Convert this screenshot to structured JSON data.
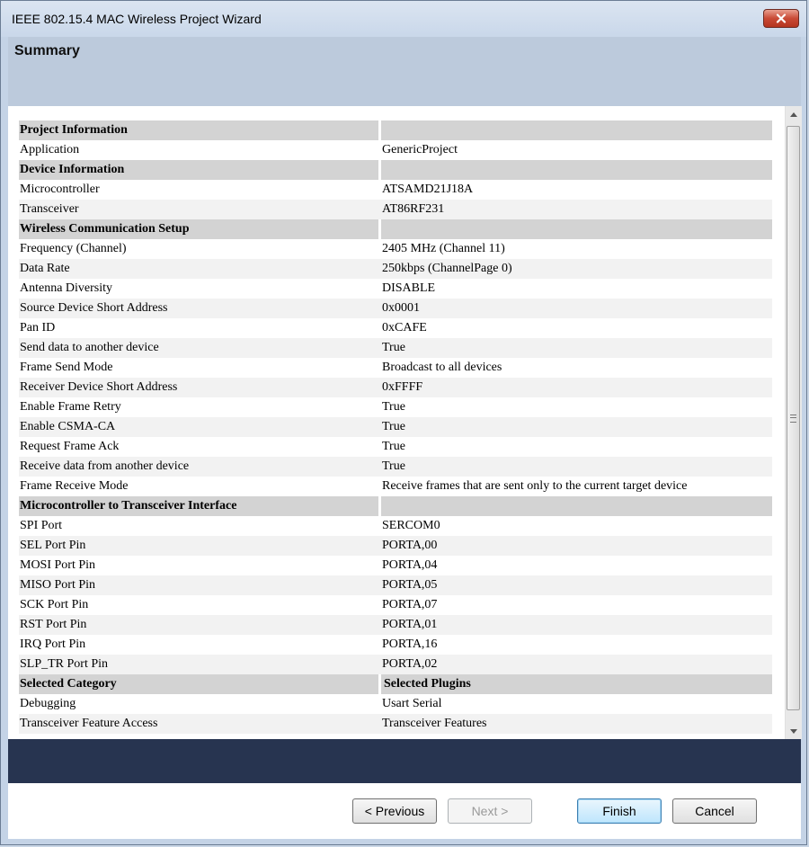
{
  "window": {
    "title": "IEEE 802.15.4 MAC Wireless Project Wizard"
  },
  "header": {
    "title": "Summary"
  },
  "rows": [
    {
      "type": "section",
      "c1": "Project Information",
      "c2": ""
    },
    {
      "type": "item",
      "c1": "Application",
      "c2": "GenericProject"
    },
    {
      "type": "section",
      "c1": "Device Information",
      "c2": ""
    },
    {
      "type": "item",
      "c1": "Microcontroller",
      "c2": "ATSAMD21J18A"
    },
    {
      "type": "item",
      "c1": "Transceiver",
      "c2": "AT86RF231"
    },
    {
      "type": "section",
      "c1": "Wireless Communication Setup",
      "c2": ""
    },
    {
      "type": "item",
      "c1": "Frequency (Channel)",
      "c2": "2405 MHz (Channel 11)"
    },
    {
      "type": "item",
      "c1": "Data Rate",
      "c2": "250kbps (ChannelPage 0)"
    },
    {
      "type": "item",
      "c1": "Antenna Diversity",
      "c2": "DISABLE"
    },
    {
      "type": "item",
      "c1": "Source Device Short Address",
      "c2": "0x0001"
    },
    {
      "type": "item",
      "c1": "Pan ID",
      "c2": "0xCAFE"
    },
    {
      "type": "item",
      "c1": "Send data to another device",
      "c2": "True"
    },
    {
      "type": "item",
      "c1": "Frame Send Mode",
      "c2": "Broadcast to all devices"
    },
    {
      "type": "item",
      "c1": "Receiver Device Short Address",
      "c2": "0xFFFF"
    },
    {
      "type": "item",
      "c1": "Enable Frame Retry",
      "c2": "True"
    },
    {
      "type": "item",
      "c1": "Enable CSMA-CA",
      "c2": "True"
    },
    {
      "type": "item",
      "c1": "Request Frame Ack",
      "c2": "True"
    },
    {
      "type": "item",
      "c1": "Receive data from another device",
      "c2": "True"
    },
    {
      "type": "item",
      "c1": "Frame Receive Mode",
      "c2": "Receive frames that are sent only to the current target device"
    },
    {
      "type": "section",
      "c1": "Microcontroller to Transceiver Interface",
      "c2": ""
    },
    {
      "type": "item",
      "c1": "SPI Port",
      "c2": "SERCOM0"
    },
    {
      "type": "item",
      "c1": "SEL Port Pin",
      "c2": "PORTA,00"
    },
    {
      "type": "item",
      "c1": "MOSI Port Pin",
      "c2": "PORTA,04"
    },
    {
      "type": "item",
      "c1": "MISO Port Pin",
      "c2": "PORTA,05"
    },
    {
      "type": "item",
      "c1": "SCK Port Pin",
      "c2": "PORTA,07"
    },
    {
      "type": "item",
      "c1": "RST Port Pin",
      "c2": "PORTA,01"
    },
    {
      "type": "item",
      "c1": "IRQ Port Pin",
      "c2": "PORTA,16"
    },
    {
      "type": "item",
      "c1": "SLP_TR Port Pin",
      "c2": "PORTA,02"
    },
    {
      "type": "section",
      "c1": "Selected Category",
      "c2": "Selected Plugins"
    },
    {
      "type": "item",
      "c1": "Debugging",
      "c2": "Usart Serial"
    },
    {
      "type": "item",
      "c1": "Transceiver Feature Access",
      "c2": "Transceiver Features"
    }
  ],
  "buttons": {
    "previous": "< Previous",
    "next": "Next >",
    "finish": "Finish",
    "cancel": "Cancel"
  },
  "icons": {
    "close": "close-icon",
    "scroll_up": "scroll-up-arrow-icon",
    "scroll_down": "scroll-down-arrow-icon"
  },
  "colors": {
    "section_bg": "#d3d3d3",
    "alt_row_bg": "#f2f2f2",
    "footer_bar": "#273450",
    "header_panel": "#bccadc"
  }
}
